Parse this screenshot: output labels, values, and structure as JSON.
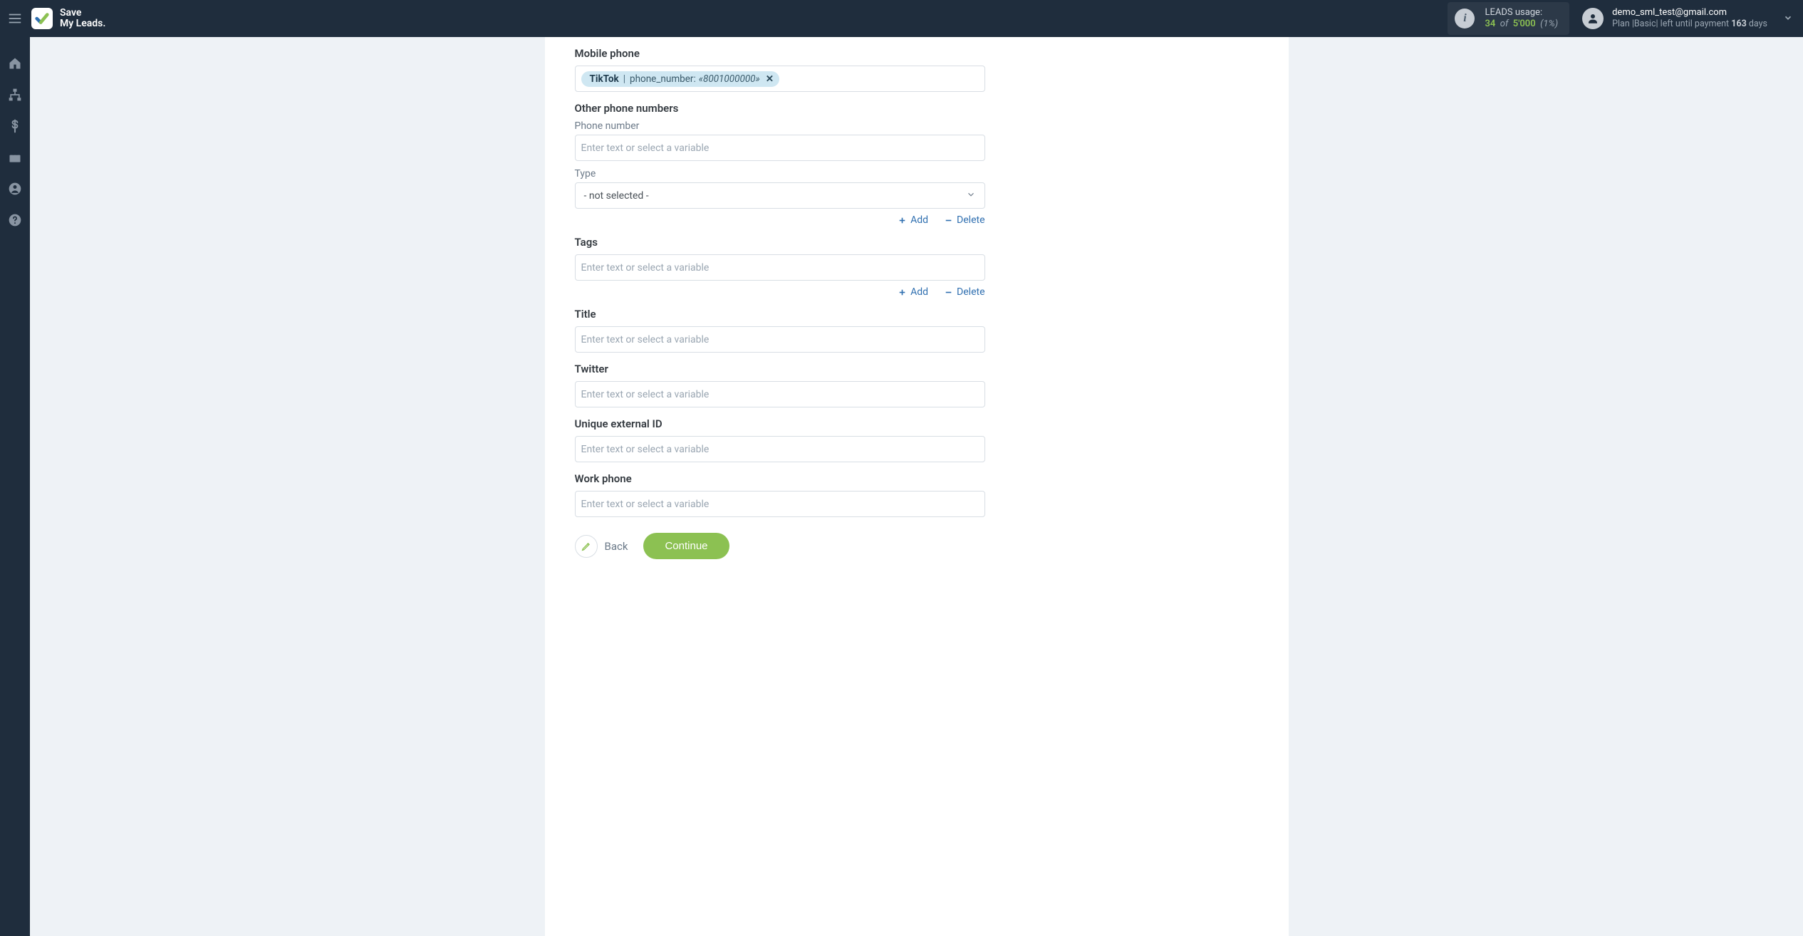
{
  "brand": {
    "line1": "Save",
    "line2": "My Leads."
  },
  "header": {
    "usage_label": "LEADS usage:",
    "usage_current": "34",
    "usage_of": "of",
    "usage_max": "5'000",
    "usage_pct": "(1%)",
    "account_email": "demo_sml_test@gmail.com",
    "plan_prefix": "Plan |",
    "plan_name": "Basic",
    "plan_mid": "| left until payment ",
    "plan_days": "163",
    "plan_suffix": " days"
  },
  "nav": {
    "items": [
      "home",
      "sitemap",
      "billing",
      "briefcase",
      "user",
      "help"
    ]
  },
  "form": {
    "placeholder": "Enter text or select a variable",
    "mobile_phone_label": "Mobile phone",
    "mobile_token": {
      "src": "TikTok",
      "key": "phone_number:",
      "val": "«8001000000»"
    },
    "other_phone_label": "Other phone numbers",
    "phone_number_label": "Phone number",
    "type_label": "Type",
    "type_selected": "- not selected -",
    "add_label": "Add",
    "delete_label": "Delete",
    "tags_label": "Tags",
    "title_label": "Title",
    "twitter_label": "Twitter",
    "uid_label": "Unique external ID",
    "work_phone_label": "Work phone",
    "back_label": "Back",
    "continue_label": "Continue"
  }
}
